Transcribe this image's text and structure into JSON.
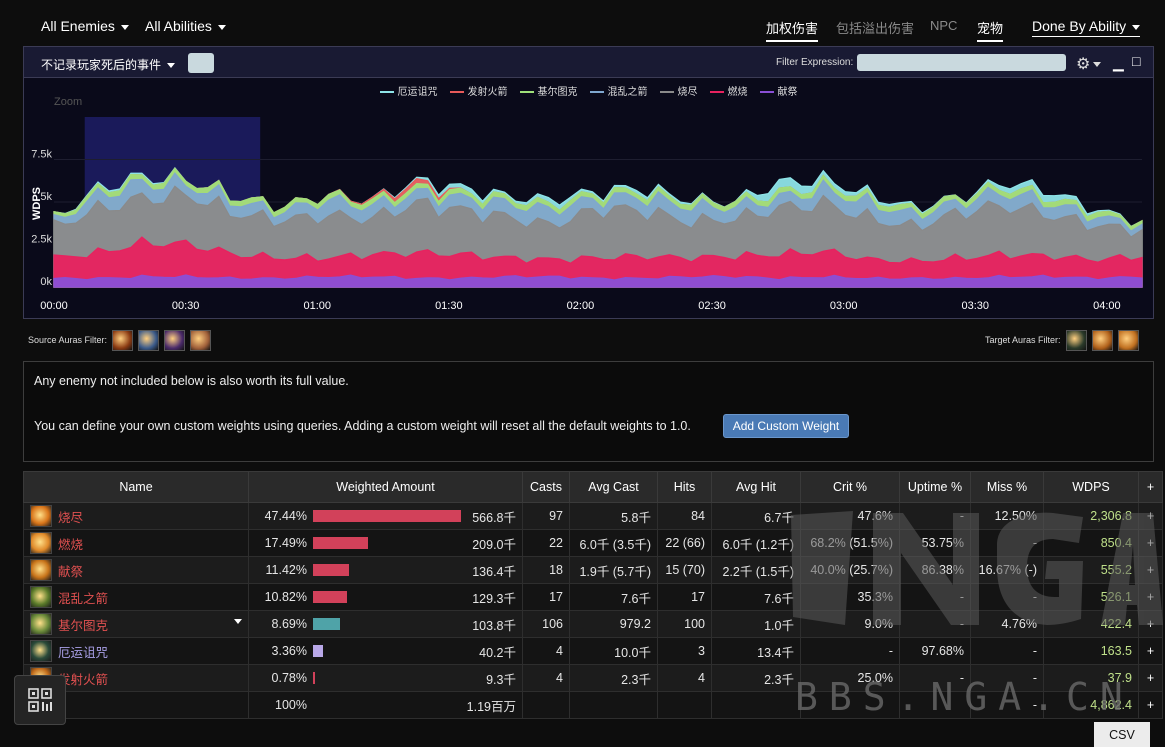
{
  "topbar": {
    "enemies_label": "All Enemies",
    "abilities_label": "All Abilities",
    "tabs": [
      {
        "label": "加权伤害",
        "active": true
      },
      {
        "label": "包括溢出伤害",
        "active": false
      },
      {
        "label": "NPC",
        "active": false
      },
      {
        "label": "宠物",
        "active": true
      }
    ],
    "view_label": "Done By Ability"
  },
  "graph_panel": {
    "death_filter_label": "不记录玩家死后的事件",
    "filter_expression_label": "Filter Expression:",
    "filter_expression_value": "",
    "gear_icon": "gear-icon",
    "min_icon": "minimize-icon",
    "max_icon": "maximize-icon"
  },
  "chart_data": {
    "type": "area",
    "ylabel": "WDPS",
    "zoom_label": "Zoom",
    "yticks": [
      "0k",
      "2.5k",
      "5k",
      "7.5k"
    ],
    "ylim": [
      0,
      10000
    ],
    "xticks": [
      "00:00",
      "00:30",
      "01:00",
      "01:30",
      "02:00",
      "02:30",
      "03:00",
      "03:30",
      "04:00"
    ],
    "xlim_seconds": [
      0,
      248
    ],
    "zoom_selection_seconds": [
      7,
      47
    ],
    "stacked": true,
    "series_order_bottom_to_top": [
      "献祭",
      "燃烧",
      "烧尽",
      "混乱之箭",
      "基尔图克",
      "发射火箭",
      "厄运诅咒"
    ],
    "legend": [
      {
        "name": "厄运诅咒",
        "color": "#8ee4e8"
      },
      {
        "name": "发射火箭",
        "color": "#e85a5a"
      },
      {
        "name": "基尔图克",
        "color": "#9fe07a"
      },
      {
        "name": "混乱之箭",
        "color": "#7fa7cf"
      },
      {
        "name": "烧尽",
        "color": "#8a8a8a"
      },
      {
        "name": "燃烧",
        "color": "#e8225f"
      },
      {
        "name": "献祭",
        "color": "#8a4fd6"
      }
    ],
    "series": [
      {
        "name": "献祭",
        "approx_values": [
          500,
          500,
          600,
          600,
          500,
          500,
          600,
          600,
          500,
          500,
          600,
          600,
          500,
          500,
          600,
          600,
          500,
          600,
          500,
          500,
          500,
          600,
          600,
          500,
          600
        ]
      },
      {
        "name": "燃烧",
        "approx_values": [
          1200,
          1500,
          2000,
          1900,
          1400,
          1200,
          1100,
          1300,
          1500,
          1400,
          1100,
          1000,
          1200,
          1300,
          1100,
          1200,
          1400,
          1500,
          1100,
          1000,
          1200,
          1300,
          1200,
          1100,
          1200
        ]
      },
      {
        "name": "烧尽",
        "approx_values": [
          1800,
          2600,
          2600,
          2900,
          2400,
          2200,
          2500,
          2100,
          2900,
          2600,
          2400,
          2000,
          2900,
          2700,
          2100,
          2200,
          2700,
          2800,
          2400,
          2000,
          2700,
          2900,
          2400,
          2000,
          1500
        ]
      },
      {
        "name": "混乱之箭",
        "approx_values": [
          300,
          800,
          900,
          600,
          700,
          500,
          900,
          700,
          600,
          700,
          800,
          900,
          600,
          800,
          900,
          700,
          600,
          800,
          900,
          700,
          600,
          800,
          700,
          500,
          300
        ]
      },
      {
        "name": "基尔图克",
        "approx_values": [
          200,
          300,
          300,
          300,
          300,
          300,
          300,
          300,
          300,
          300,
          300,
          300,
          300,
          300,
          300,
          300,
          300,
          300,
          300,
          300,
          300,
          300,
          300,
          300,
          200
        ]
      },
      {
        "name": "发射火箭",
        "approx_values": [
          0,
          0,
          0,
          0,
          0,
          0,
          0,
          100,
          300,
          0,
          0,
          0,
          0,
          0,
          0,
          0,
          0,
          0,
          0,
          0,
          0,
          0,
          0,
          0,
          0
        ]
      },
      {
        "name": "厄运诅咒",
        "approx_values": [
          0,
          100,
          100,
          0,
          0,
          0,
          0,
          0,
          100,
          300,
          100,
          300,
          100,
          200,
          100,
          0,
          600,
          300,
          200,
          100,
          0,
          300,
          400,
          100,
          0
        ]
      }
    ]
  },
  "auras": {
    "source_label": "Source Auras Filter:",
    "target_label": "Target Auras Filter:",
    "source_icons": [
      {
        "name": "source-aura-1-icon",
        "color": "#8a3a12"
      },
      {
        "name": "source-aura-2-icon",
        "color": "#3a5a8a"
      },
      {
        "name": "source-aura-3-icon",
        "color": "#4a2a6a"
      },
      {
        "name": "source-aura-4-icon",
        "color": "#a0603a"
      }
    ],
    "target_icons": [
      {
        "name": "target-aura-1-icon",
        "color": "#2a3a2a"
      },
      {
        "name": "target-aura-2-icon",
        "color": "#b0601a"
      },
      {
        "name": "target-aura-3-icon",
        "color": "#c07020"
      }
    ]
  },
  "info": {
    "line1": "Any enemy not included below is also worth its full value.",
    "line2": "You can define your own custom weights using queries. Adding a custom weight will reset all the default weights to 1.0.",
    "add_button": "Add Custom Weight"
  },
  "table": {
    "headers": [
      "Name",
      "Weighted Amount",
      "Casts",
      "Avg Cast",
      "Hits",
      "Avg Hit",
      "Crit %",
      "Uptime %",
      "Miss %",
      "WDPS",
      "+"
    ],
    "rows": [
      {
        "name": "烧尽",
        "name_color": "#e05050",
        "icon_color": "#d9751a",
        "pct": "47.44%",
        "fraction": 0.4744,
        "bar_color": "#d2415a",
        "amount": "566.8千",
        "casts": "97",
        "avg_cast": "5.8千",
        "hits": "84",
        "avg_hit": "6.7千",
        "crit": "47.6%",
        "uptime": "-",
        "miss": "12.50%",
        "wdps": "2,306.8",
        "expand": false
      },
      {
        "name": "燃烧",
        "name_color": "#e05050",
        "icon_color": "#e08a2a",
        "pct": "17.49%",
        "fraction": 0.1749,
        "bar_color": "#d2415a",
        "amount": "209.0千",
        "casts": "22",
        "avg_cast": "6.0千 (3.5千)",
        "hits": "22 (66)",
        "avg_hit": "6.0千 (1.2千)",
        "crit": "68.2% (51.5%)",
        "uptime": "53.75%",
        "miss": "-",
        "wdps": "850.4",
        "expand": false
      },
      {
        "name": "献祭",
        "name_color": "#e05050",
        "icon_color": "#c8741a",
        "pct": "11.42%",
        "fraction": 0.1142,
        "bar_color": "#d2415a",
        "amount": "136.4千",
        "casts": "18",
        "avg_cast": "1.9千 (5.7千)",
        "hits": "15 (70)",
        "avg_hit": "2.2千 (1.5千)",
        "crit": "40.0% (25.7%)",
        "uptime": "86.38%",
        "miss": "16.67% (-)",
        "wdps": "555.2",
        "expand": false
      },
      {
        "name": "混乱之箭",
        "name_color": "#e05050",
        "icon_color": "#5a7a2a",
        "pct": "10.82%",
        "fraction": 0.1082,
        "bar_color": "#d2415a",
        "amount": "129.3千",
        "casts": "17",
        "avg_cast": "7.6千",
        "hits": "17",
        "avg_hit": "7.6千",
        "crit": "35.3%",
        "uptime": "-",
        "miss": "-",
        "wdps": "526.1",
        "expand": false
      },
      {
        "name": "基尔图克",
        "name_color": "#e05050",
        "icon_color": "#6a8a3a",
        "pct": "8.69%",
        "fraction": 0.0869,
        "bar_color": "#4fa3a8",
        "amount": "103.8千",
        "casts": "106",
        "avg_cast": "979.2",
        "hits": "100",
        "avg_hit": "1.0千",
        "crit": "9.0%",
        "uptime": "-",
        "miss": "4.76%",
        "wdps": "422.4",
        "expand": true
      },
      {
        "name": "厄运诅咒",
        "name_color": "#a9a0e8",
        "icon_color": "#2a4a3a",
        "pct": "3.36%",
        "fraction": 0.0336,
        "bar_color": "#b9a8e8",
        "amount": "40.2千",
        "casts": "4",
        "avg_cast": "10.0千",
        "hits": "3",
        "avg_hit": "13.4千",
        "crit": "-",
        "uptime": "97.68%",
        "miss": "-",
        "wdps": "163.5",
        "expand": false
      },
      {
        "name": "发射火箭",
        "name_color": "#e05050",
        "icon_color": "#c06a1a",
        "pct": "0.78%",
        "fraction": 0.0078,
        "bar_color": "#d2415a",
        "amount": "9.3千",
        "casts": "4",
        "avg_cast": "2.3千",
        "hits": "4",
        "avg_hit": "2.3千",
        "crit": "25.0%",
        "uptime": "-",
        "miss": "-",
        "wdps": "37.9",
        "expand": false
      }
    ],
    "total": {
      "pct": "100%",
      "amount": "1.19百万",
      "miss": "-",
      "wdps": "4,862.4"
    }
  },
  "csv_label": "CSV",
  "watermark": "BBS.NGA.CN"
}
